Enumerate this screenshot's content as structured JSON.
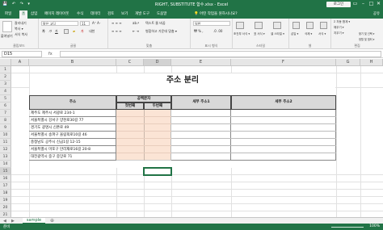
{
  "window": {
    "title": "RIGHT, SUBSTITUTE 함수.xlsx  -  Excel",
    "login_label": "로그인",
    "quick_access": "💾 ↶ ↷ ▾"
  },
  "tabs": [
    "파일",
    "홈",
    "삽입",
    "페이지 레이아웃",
    "수식",
    "데이터",
    "검토",
    "보기",
    "개발 도구",
    "도움말"
  ],
  "active_tab_index": 1,
  "tell_me": "💡 어떤 작업을 원하시나요?",
  "share": "공유",
  "ribbon": {
    "clipboard": {
      "paste": "붙여넣기",
      "cut": "잘라내기",
      "copy": "복사 ▾",
      "format_painter": "서식 복사",
      "label": "클립보드"
    },
    "font": {
      "name": "맑은 고딕",
      "size": "11",
      "label": "글꼴"
    },
    "alignment": {
      "wrap": "텍스트 줄 바꿈",
      "merge": "병합하고 가운데 맞춤 ▾",
      "label": "맞춤"
    },
    "number": {
      "format": "일반",
      "label": "표시 형식"
    },
    "styles": {
      "conditional": "조건부 서식 ▾",
      "table": "표 서식 ▾",
      "cell": "셀 스타일 ▾",
      "label": "스타일"
    },
    "cells": {
      "insert": "삽입 ▾",
      "delete": "삭제 ▾",
      "format": "서식 ▾",
      "label": "셀"
    },
    "editing": {
      "autosum": "Σ 자동 합계 ▾",
      "fill": "채우기 ▾",
      "clear": "지우기 ▾",
      "sort": "정렬 및 필터 ▾",
      "find": "찾기 및 선택 ▾",
      "label": "편집"
    }
  },
  "formula_bar": {
    "name_box": "D15",
    "fx": "fx",
    "formula": ""
  },
  "columns": [
    "A",
    "B",
    "C",
    "D",
    "E",
    "F",
    "G",
    "H"
  ],
  "rows": [
    "1",
    "2",
    "3",
    "4",
    "5",
    "6",
    "7",
    "8",
    "9",
    "10",
    "11",
    "12",
    "13",
    "14",
    "15",
    "16",
    "17",
    "18",
    "19",
    "20",
    "21"
  ],
  "sheet": {
    "title": "주소 분리",
    "headers": {
      "address": "주소",
      "space_char": "공백문자",
      "first": "첫번째",
      "second": "두번째",
      "detail1": "세부 주소1",
      "detail2": "세부 주소2"
    },
    "addresses": [
      "제주도 제주시 서광로 234-1",
      "서울특별시 강서구 양천로30길 77",
      "경기도 광명시 신촌로 49",
      "서울특별시 송파구 올림픽로10길 46",
      "충청남도 공주시 신금1길 12-15",
      "서울특별시 마포구 만리재로16길 20-8",
      "대전광역시 중구 중앙로 71"
    ]
  },
  "sheet_tabs": [
    "sample"
  ],
  "status": {
    "ready": "준비",
    "zoom": "100%"
  },
  "colors": {
    "accent": "#217346",
    "header_fill": "#d9d9d9",
    "peach_fill": "#fbe4d5"
  }
}
